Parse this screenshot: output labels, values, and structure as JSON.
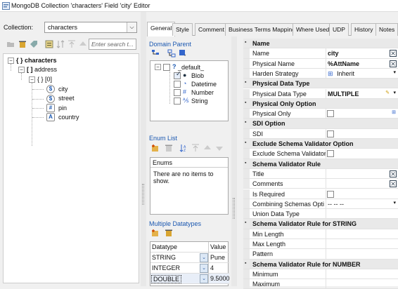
{
  "window": {
    "title": "MongoDB Collection 'characters' Field 'city' Editor"
  },
  "collection": {
    "label": "Collection:",
    "value": "characters"
  },
  "left_toolbar": {
    "search_placeholder": "Enter search t..."
  },
  "tree": {
    "root": "characters",
    "address": "address",
    "index": "[0]",
    "fields": [
      "city",
      "street",
      "pin",
      "country"
    ]
  },
  "tabs": [
    "General",
    "Style",
    "Comment",
    "Business Terms Mapping",
    "Where Used",
    "UDP",
    "History",
    "Notes"
  ],
  "domain_parent": {
    "title": "Domain Parent",
    "root": "_default_",
    "items": [
      "Blob",
      "Datetime",
      "Number",
      "String"
    ]
  },
  "enum_list": {
    "title": "Enum List",
    "header": "Enums",
    "empty": "There are no items to show."
  },
  "multiple_datatypes": {
    "title": "Multiple Datatypes",
    "headers": [
      "Datatype",
      "Value"
    ],
    "rows": [
      {
        "type": "STRING",
        "value": "Pune"
      },
      {
        "type": "INTEGER",
        "value": "4"
      },
      {
        "type": "DOUBLE",
        "value": "9.5000"
      }
    ]
  },
  "properties": {
    "name_cat": "Name",
    "name_label": "Name",
    "name_value": "city",
    "physical_name_label": "Physical Name",
    "physical_name_value": "%AttName",
    "harden_label": "Harden Strategy",
    "harden_value": "Inherit",
    "pdt_cat": "Physical Data Type",
    "pdt_label": "Physical Data Type",
    "pdt_value": "MULTIPLE",
    "poo_cat": "Physical Only Option",
    "po_label": "Physical Only",
    "sdi_cat": "SDI Option",
    "sdi_label": "SDI",
    "esv_cat": "Exclude Schema Validator Option",
    "esv_label": "Exclude Schema Validator",
    "svr_cat": "Schema Validator Rule",
    "title_label": "Title",
    "comments_label": "Comments",
    "required_label": "Is Required",
    "combining_label": "Combining Schemas Opti",
    "combining_value": "-- -- --",
    "union_label": "Union Data Type",
    "svr_string_cat": "Schema Validator Rule for STRING",
    "min_len_label": "Min Length",
    "max_len_label": "Max Length",
    "pattern_label": "Pattern",
    "svr_number_cat": "Schema Validator Rule for NUMBER",
    "minimum_label": "Minimum",
    "maximum_label": "Maximum"
  }
}
